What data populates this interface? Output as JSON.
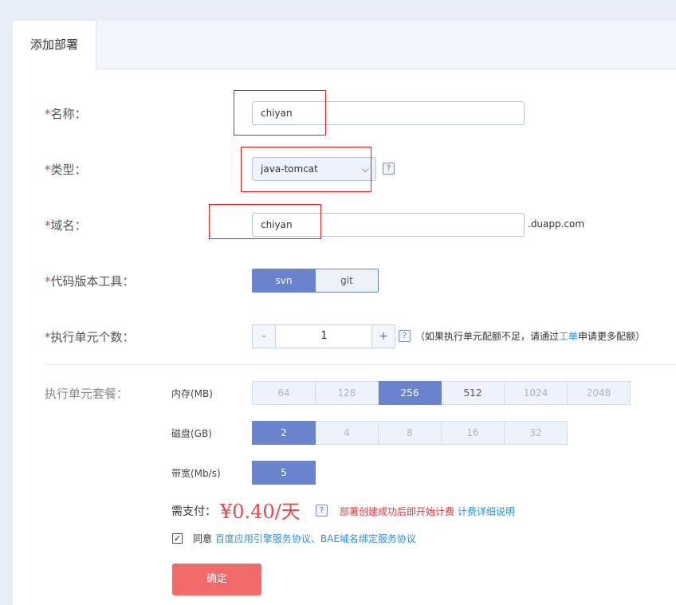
{
  "tab": {
    "label": "添加部署"
  },
  "form": {
    "name": {
      "required": "*",
      "label": "名称：",
      "value": "chiyan"
    },
    "type": {
      "required": "*",
      "label": "类型：",
      "value": "java-tomcat",
      "help": "?"
    },
    "domain": {
      "required": "*",
      "label": "域名：",
      "value": "chiyan",
      "suffix": ".duapp.com"
    },
    "vcs": {
      "required": "*",
      "label": "代码版本工具：",
      "options": [
        "svn",
        "git"
      ],
      "selected": "svn"
    },
    "units": {
      "required": "*",
      "label": "执行单元个数：",
      "minus": "-",
      "value": "1",
      "plus": "+",
      "help": "?",
      "hint_prefix": "（如果执行单元配额不足，请通过",
      "hint_link": "工单",
      "hint_suffix": "申请更多配额）"
    }
  },
  "package": {
    "label": "执行单元套餐：",
    "memory": {
      "label": "内存(MB)",
      "options": [
        "64",
        "128",
        "256",
        "512",
        "1024",
        "2048"
      ],
      "selected": "256"
    },
    "disk": {
      "label": "磁盘(GB)",
      "options": [
        "2",
        "4",
        "8",
        "16",
        "32"
      ],
      "selected": "2"
    },
    "bandwidth": {
      "label": "带宽(Mb/s)",
      "options": [
        "5"
      ],
      "selected": "5"
    }
  },
  "payment": {
    "label": "需支付：",
    "price": "¥0.40/天",
    "help": "?",
    "notice": "部署创建成功后即开始计费",
    "detail_link": "计费详细说明"
  },
  "agreement": {
    "checked": true,
    "check_glyph": "✓",
    "prefix": "同意",
    "link1": "百度应用引擎服务协议",
    "sep": "、",
    "link2": "BAE域名绑定服务协议"
  },
  "submit": {
    "label": "确定"
  },
  "colors": {
    "accent": "#6983cf",
    "danger": "#f06a6a",
    "link": "#2f8fd6"
  }
}
